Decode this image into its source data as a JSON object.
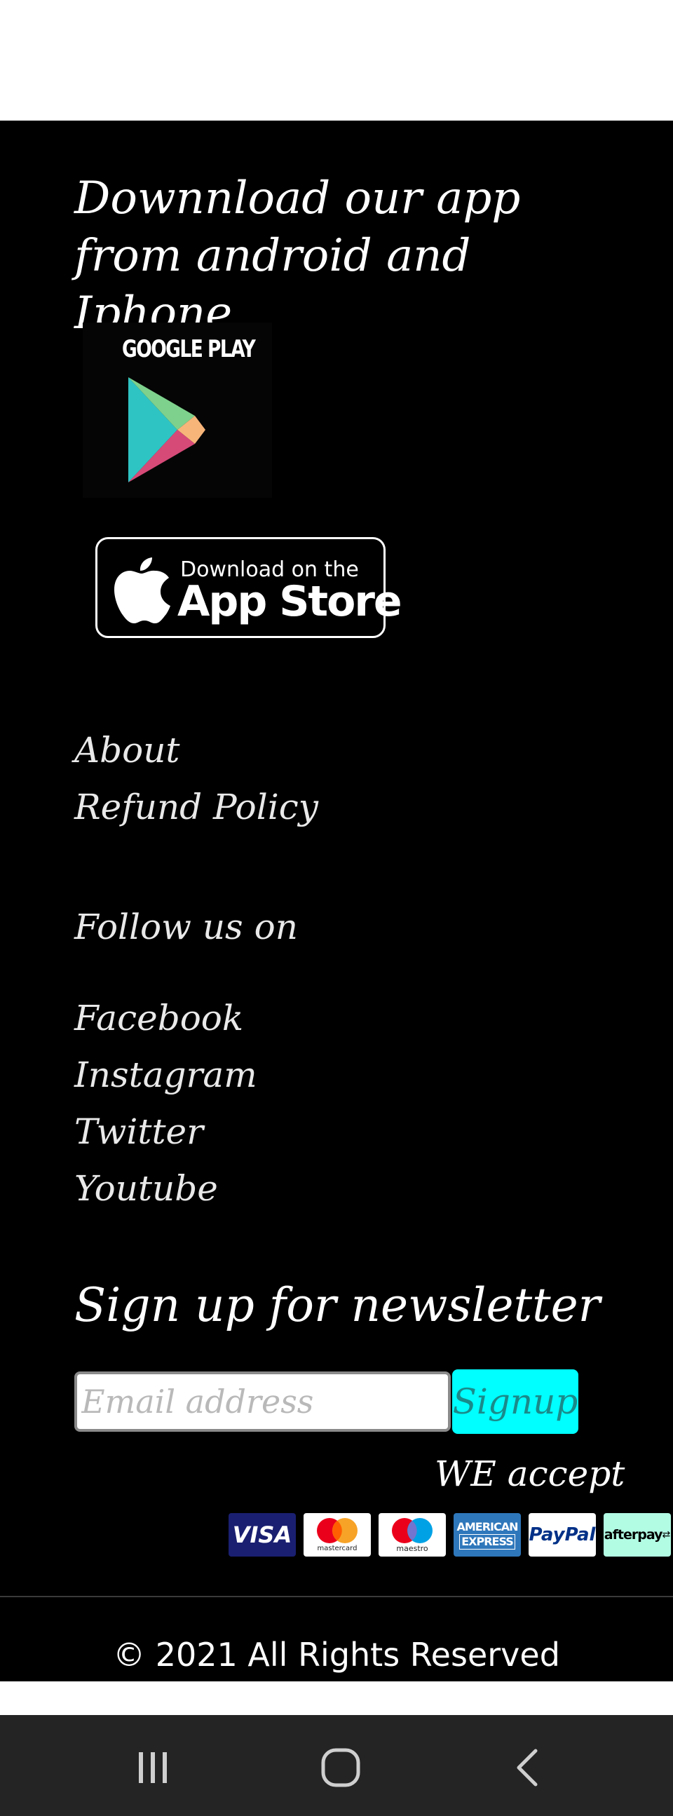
{
  "app_section": {
    "heading": "Downnload our app from android and Iphone",
    "google_play_label": "GOOGLE PLAY",
    "app_store_small": "Download on the",
    "app_store_big": "App Store"
  },
  "links": [
    "About",
    "Refund Policy"
  ],
  "follow": {
    "heading": "Follow us on",
    "items": [
      "Facebook",
      "Instagram",
      "Twitter",
      "Youtube"
    ]
  },
  "newsletter": {
    "heading": "Sign up for newsletter",
    "email_placeholder": "Email address",
    "signup_label": "Signup"
  },
  "payments": {
    "heading": "WE accept",
    "cards": [
      {
        "name": "visa",
        "label": "VISA",
        "bg": "#1a1f71",
        "fg": "#ffffff"
      },
      {
        "name": "mastercard",
        "label": "mastercard",
        "bg": "#ffffff",
        "fg": "#222222"
      },
      {
        "name": "maestro",
        "label": "maestro",
        "bg": "#ffffff",
        "fg": "#222222"
      },
      {
        "name": "american-express",
        "label_top": "AMERICAN",
        "label_bottom": "EXPRESS",
        "bg": "#2e77bb",
        "fg": "#ffffff"
      },
      {
        "name": "paypal",
        "label": "PayPal",
        "bg": "#ffffff",
        "fg": "#003087"
      },
      {
        "name": "afterpay",
        "label": "afterpay",
        "bg": "#b2fce4",
        "fg": "#000000"
      }
    ]
  },
  "copyright": "© 2021 All Rights Reserved",
  "colors": {
    "footer_bg": "#000000",
    "accent": "#00ffff",
    "navbar_bg": "#242424"
  },
  "navbar": {
    "icons": [
      "recent-apps-icon",
      "home-icon",
      "back-icon"
    ]
  }
}
